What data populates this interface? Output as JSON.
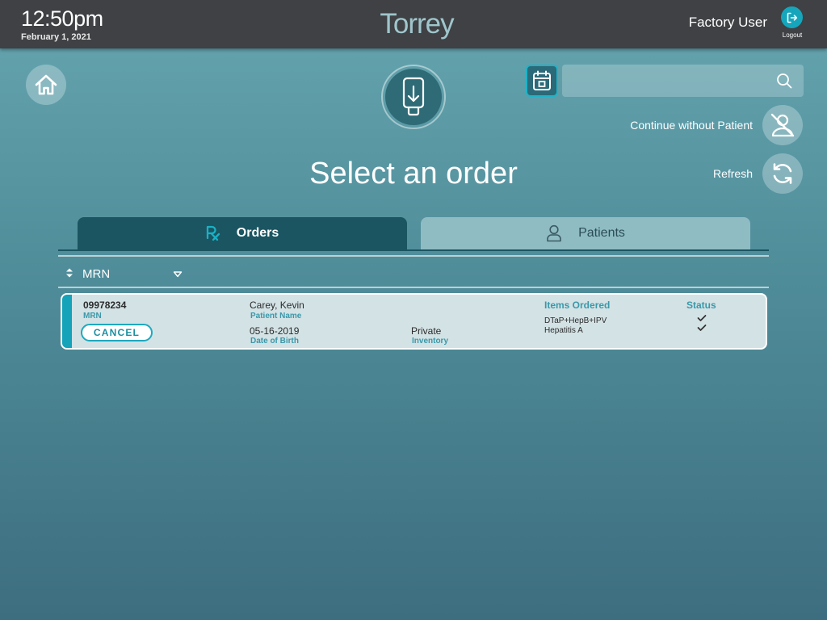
{
  "header": {
    "time": "12:50pm",
    "date": "February 1, 2021",
    "app_title": "Torrey",
    "user": "Factory User",
    "logout_label": "Logout"
  },
  "search": {
    "placeholder": "",
    "value": ""
  },
  "actions": {
    "continue_without_patient": "Continue without Patient",
    "refresh": "Refresh"
  },
  "page": {
    "title": "Select an order"
  },
  "tabs": [
    {
      "label": "Orders",
      "active": true
    },
    {
      "label": "Patients",
      "active": false
    }
  ],
  "sort": {
    "label": "MRN"
  },
  "orders": [
    {
      "mrn": "09978234",
      "mrn_label": "MRN",
      "patient_name": "Carey, Kevin",
      "patient_name_label": "Patient Name",
      "dob": "05-16-2019",
      "dob_label": "Date of Birth",
      "inventory": "Private",
      "inventory_label": "Inventory",
      "items_header": "Items Ordered",
      "status_header": "Status",
      "items": [
        "DTaP+HepB+IPV",
        "Hepatitis A"
      ],
      "cancel_label": "CANCEL"
    }
  ],
  "colors": {
    "accent": "#14a3b8",
    "topbar": "#3f4144",
    "active_tab": "#1a5561",
    "inactive_tab": "#8fbcc3"
  },
  "icons": {
    "logout": "logout-icon",
    "home": "home-icon",
    "scanner": "scanner-icon",
    "calendar": "calendar-icon",
    "search": "search-icon",
    "no_patient": "no-patient-icon",
    "refresh": "refresh-icon",
    "rx": "rx-icon",
    "person": "person-icon",
    "sort": "sort-arrows-icon",
    "dropdown": "chevron-down-icon",
    "check": "check-icon"
  }
}
